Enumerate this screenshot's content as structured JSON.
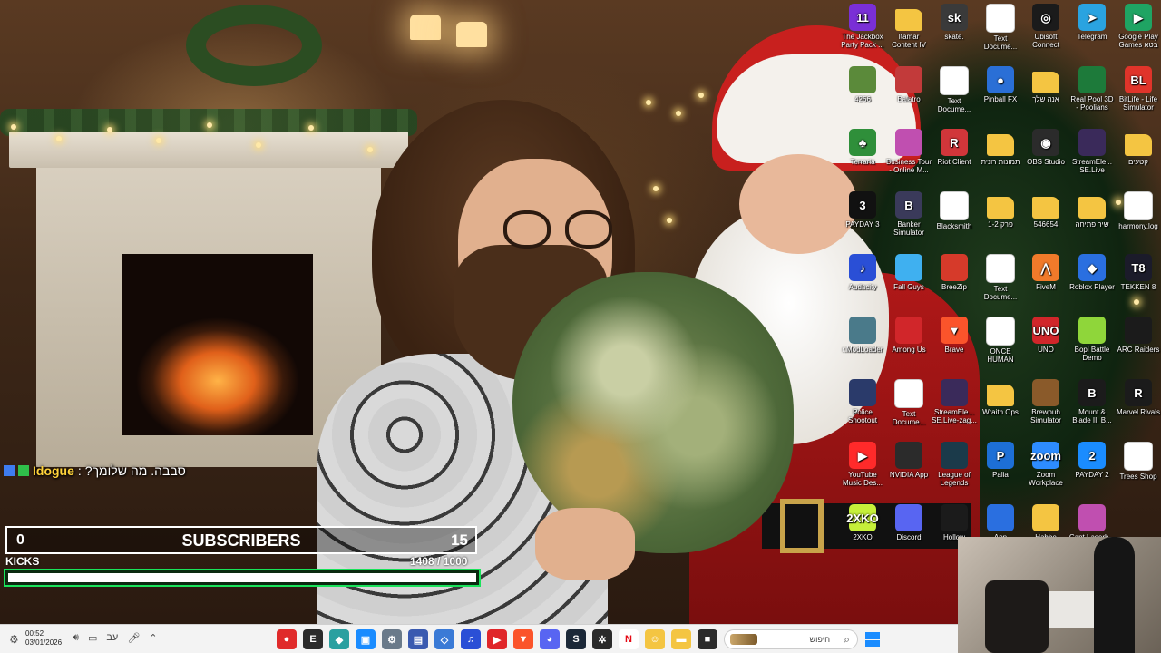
{
  "chat": {
    "username": "Idogue",
    "separator": ":",
    "message": "סבבה. מה שלומך?"
  },
  "subscribers": {
    "current": "0",
    "label": "SUBSCRIBERS",
    "goal": "15"
  },
  "kicks": {
    "label": "KICKS",
    "count": "1408",
    "goal": "/ 1000",
    "progress_fraction": 1.0
  },
  "desktop_icons": [
    {
      "label": "The Jackbox Party Pack ...",
      "icon": "jackbox-icon",
      "color": "#7a2fd6",
      "glyph": "11"
    },
    {
      "label": "Itamar Content IV",
      "icon": "folder-icon",
      "color": "#f4c542",
      "glyph": ""
    },
    {
      "label": "skate.",
      "icon": "skate-icon",
      "color": "#3a3a3a",
      "glyph": "sk"
    },
    {
      "label": "Text Docume...",
      "icon": "text-document-icon",
      "color": "#ffffff",
      "glyph": ""
    },
    {
      "label": "Ubisoft Connect",
      "icon": "ubisoft-icon",
      "color": "#1b1b1b",
      "glyph": "◎"
    },
    {
      "label": "Telegram",
      "icon": "telegram-icon",
      "color": "#2aa3e0",
      "glyph": "➤"
    },
    {
      "label": "Google Play Games בטא",
      "icon": "google-play-games-icon",
      "color": "#1fa463",
      "glyph": "▶"
    },
    {
      "label": "4266",
      "icon": "shortcut-icon",
      "color": "#5b8a3a",
      "glyph": ""
    },
    {
      "label": "Balatro",
      "icon": "balatro-icon",
      "color": "#c23a3a",
      "glyph": ""
    },
    {
      "label": "Text Docume...",
      "icon": "text-document-icon",
      "color": "#ffffff",
      "glyph": ""
    },
    {
      "label": "Pinball FX",
      "icon": "pinball-fx-icon",
      "color": "#2a6fd6",
      "glyph": "●"
    },
    {
      "label": "אנה שלך",
      "icon": "folder-icon",
      "color": "#f4c542",
      "glyph": ""
    },
    {
      "label": "Real Pool 3D - Poolians",
      "icon": "real-pool-icon",
      "color": "#1d7a3a",
      "glyph": ""
    },
    {
      "label": "BitLife - Life Simulator",
      "icon": "bitlife-icon",
      "color": "#e0342a",
      "glyph": "BL"
    },
    {
      "label": "Terraria",
      "icon": "terraria-icon",
      "color": "#2f8f3a",
      "glyph": "♣"
    },
    {
      "label": "Business Tour - Online M...",
      "icon": "business-tour-icon",
      "color": "#c04fb0",
      "glyph": ""
    },
    {
      "label": "Riot Client",
      "icon": "riot-client-icon",
      "color": "#d1363a",
      "glyph": "R"
    },
    {
      "label": "תמונות רונית",
      "icon": "folder-icon",
      "color": "#f4c542",
      "glyph": ""
    },
    {
      "label": "OBS Studio",
      "icon": "obs-studio-icon",
      "color": "#2b2b2b",
      "glyph": "◉"
    },
    {
      "label": "StreamEle... SE.Live",
      "icon": "streamelements-icon",
      "color": "#3a2a5a",
      "glyph": ""
    },
    {
      "label": "קטעים",
      "icon": "folder-icon",
      "color": "#f4c542",
      "glyph": ""
    },
    {
      "label": "PAYDAY 3",
      "icon": "payday3-icon",
      "color": "#111111",
      "glyph": "3"
    },
    {
      "label": "Banker Simulator",
      "icon": "banker-simulator-icon",
      "color": "#3a3a5a",
      "glyph": "B"
    },
    {
      "label": "Blacksmith",
      "icon": "blacksmith-icon",
      "color": "#ffffff",
      "glyph": ""
    },
    {
      "label": "1-2 פרק",
      "icon": "folder-icon",
      "color": "#f4c542",
      "glyph": ""
    },
    {
      "label": "546654",
      "icon": "folder-icon",
      "color": "#f4c542",
      "glyph": ""
    },
    {
      "label": "שיר פתיחה",
      "icon": "folder-icon",
      "color": "#f4c542",
      "glyph": ""
    },
    {
      "label": "harmony.log",
      "icon": "log-file-icon",
      "color": "#ffffff",
      "glyph": ""
    },
    {
      "label": "Audacity",
      "icon": "audacity-icon",
      "color": "#2a4fd6",
      "glyph": "♪"
    },
    {
      "label": "Fall Guys",
      "icon": "fall-guys-icon",
      "color": "#3fb0f0",
      "glyph": ""
    },
    {
      "label": "BreeZip",
      "icon": "breezip-icon",
      "color": "#d63a2a",
      "glyph": ""
    },
    {
      "label": "Text Docume...",
      "icon": "text-document-icon",
      "color": "#ffffff",
      "glyph": ""
    },
    {
      "label": "FiveM",
      "icon": "fivem-icon",
      "color": "#f07a2a",
      "glyph": "⋀"
    },
    {
      "label": "Roblox Player",
      "icon": "roblox-icon",
      "color": "#2a6fe0",
      "glyph": "◆"
    },
    {
      "label": "TEKKEN 8",
      "icon": "tekken8-icon",
      "color": "#1b1b2a",
      "glyph": "T8"
    },
    {
      "label": "r.ModLoader",
      "icon": "modloader-icon",
      "color": "#4a7a8a",
      "glyph": ""
    },
    {
      "label": "Among Us",
      "icon": "among-us-icon",
      "color": "#d1262a",
      "glyph": ""
    },
    {
      "label": "Brave",
      "icon": "brave-icon",
      "color": "#fb542b",
      "glyph": "▼"
    },
    {
      "label": "ONCE HUMAN",
      "icon": "once-human-icon",
      "color": "#ffffff",
      "glyph": ""
    },
    {
      "label": "UNO",
      "icon": "uno-icon",
      "color": "#d1262a",
      "glyph": "UNO"
    },
    {
      "label": "Bopl Battle Demo",
      "icon": "bopl-battle-icon",
      "color": "#8fd63a",
      "glyph": ""
    },
    {
      "label": "ARC Raiders",
      "icon": "arc-raiders-icon",
      "color": "#1b1b1b",
      "glyph": ""
    },
    {
      "label": "Police Shootout",
      "icon": "police-shootout-icon",
      "color": "#2a3a6a",
      "glyph": ""
    },
    {
      "label": "Text Docume...",
      "icon": "text-document-icon",
      "color": "#ffffff",
      "glyph": ""
    },
    {
      "label": "StreamEle... SE.Live-zag...",
      "icon": "streamelements-icon",
      "color": "#3a2a5a",
      "glyph": ""
    },
    {
      "label": "Wraith Ops",
      "icon": "folder-icon",
      "color": "#f4c542",
      "glyph": ""
    },
    {
      "label": "Brewpub Simulator",
      "icon": "brewpub-simulator-icon",
      "color": "#8a5a2a",
      "glyph": ""
    },
    {
      "label": "Mount & Blade II: B...",
      "icon": "mount-blade-icon",
      "color": "#1b1b1b",
      "glyph": "B"
    },
    {
      "label": "Marvel Rivals",
      "icon": "marvel-rivals-icon",
      "color": "#1b1b1b",
      "glyph": "R"
    },
    {
      "label": "YouTube Music Des...",
      "icon": "youtube-music-icon",
      "color": "#ff2a2a",
      "glyph": "▶"
    },
    {
      "label": "NVIDIA App",
      "icon": "nvidia-icon",
      "color": "#2b2b2b",
      "glyph": ""
    },
    {
      "label": "League of Legends",
      "icon": "league-of-legends-icon",
      "color": "#1b3a4a",
      "glyph": ""
    },
    {
      "label": "Palia",
      "icon": "palia-icon",
      "color": "#1d6fd6",
      "glyph": "P"
    },
    {
      "label": "Zoom Workplace",
      "icon": "zoom-icon",
      "color": "#2d8cff",
      "glyph": "zoom"
    },
    {
      "label": "PAYDAY 2",
      "icon": "payday2-icon",
      "color": "#1a8cff",
      "glyph": "2"
    },
    {
      "label": "Trees Shop",
      "icon": "trees-shop-icon",
      "color": "#ffffff",
      "glyph": ""
    },
    {
      "label": "2XKO",
      "icon": "2xko-icon",
      "color": "#c6f03a",
      "glyph": "2XKO"
    },
    {
      "label": "Discord",
      "icon": "discord-icon",
      "color": "#5865f2",
      "glyph": ""
    },
    {
      "label": "Hollow",
      "icon": "hollow-icon",
      "color": "#1b1b1b",
      "glyph": ""
    },
    {
      "label": "App",
      "icon": "app-icon",
      "color": "#2a6fe0",
      "glyph": ""
    },
    {
      "label": "Habbo Launcher",
      "icon": "habbo-icon",
      "color": "#f4c542",
      "glyph": ""
    },
    {
      "label": "Capt Laserh...",
      "icon": "capt-laserhawk-icon",
      "color": "#c04fb0",
      "glyph": ""
    }
  ],
  "taskbar": {
    "time": "00:52",
    "date": "03/01/2026",
    "language": "עב",
    "search_placeholder": "חיפוש",
    "apps": [
      {
        "icon": "record-app-icon",
        "color": "#e02a2a",
        "glyph": "●"
      },
      {
        "icon": "epic-games-icon",
        "color": "#2b2b2b",
        "glyph": "E"
      },
      {
        "icon": "browser-app-icon",
        "color": "#2aa0a0",
        "glyph": "◆"
      },
      {
        "icon": "store-app-icon",
        "color": "#1a8cff",
        "glyph": "▣"
      },
      {
        "icon": "settings-app-icon",
        "color": "#6a7a8a",
        "glyph": "⚙"
      },
      {
        "icon": "tool-app-icon",
        "color": "#3a5ab0",
        "glyph": "▤"
      },
      {
        "icon": "diamond-app-icon",
        "color": "#3a7ad6",
        "glyph": "◇"
      },
      {
        "icon": "headphones-app-icon",
        "color": "#2a4fd6",
        "glyph": "♫"
      },
      {
        "icon": "media-app-icon",
        "color": "#e0262a",
        "glyph": "▶"
      },
      {
        "icon": "brave-taskbar-icon",
        "color": "#fb542b",
        "glyph": "▼"
      },
      {
        "icon": "discord-taskbar-icon",
        "color": "#5865f2",
        "glyph": "◕"
      },
      {
        "icon": "steam-icon",
        "color": "#1b2838",
        "glyph": "S"
      },
      {
        "icon": "chatgpt-icon",
        "color": "#2b2b2b",
        "glyph": "✲"
      },
      {
        "icon": "netflix-icon",
        "color": "#ffffff",
        "glyph": "N"
      },
      {
        "icon": "game-app-icon",
        "color": "#f4c542",
        "glyph": "☺"
      },
      {
        "icon": "file-explorer-icon",
        "color": "#f4c542",
        "glyph": "▬"
      },
      {
        "icon": "terminal-icon",
        "color": "#2b2b2b",
        "glyph": "■"
      }
    ]
  }
}
